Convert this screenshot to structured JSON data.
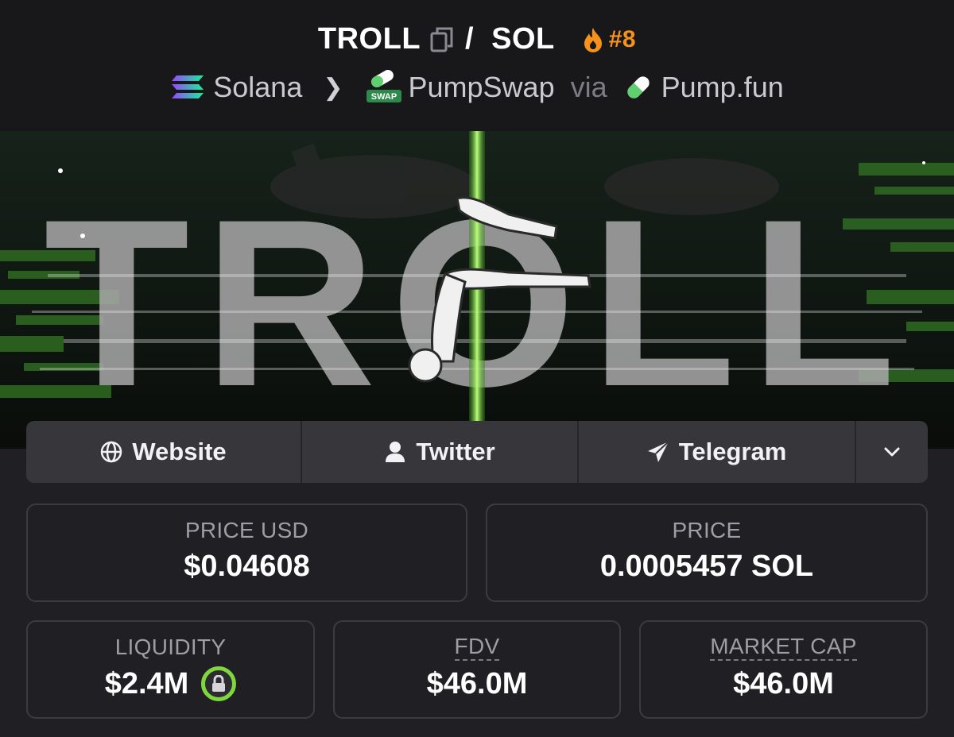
{
  "pair": {
    "base": "TROLL",
    "separator": "/",
    "quote": "SOL",
    "rank": "#8"
  },
  "route": {
    "chain": "Solana",
    "dex": "PumpSwap",
    "via_label": "via",
    "launchpad": "Pump.fun",
    "dex_badge_text": "SWAP"
  },
  "banner": {
    "text": "TROLL"
  },
  "links": {
    "website": "Website",
    "twitter": "Twitter",
    "telegram": "Telegram"
  },
  "stats": {
    "price_usd_label": "PRICE USD",
    "price_usd": "$0.04608",
    "price_label": "PRICE",
    "price": "0.0005457 SOL",
    "liquidity_label": "LIQUIDITY",
    "liquidity": "$2.4M",
    "fdv_label": "FDV",
    "fdv": "$46.0M",
    "mcap_label": "MARKET CAP",
    "mcap": "$46.0M"
  },
  "colors": {
    "rank": "#f7931a",
    "lock_ring": "#7fd73f",
    "banner_pole": "#7dff3a"
  },
  "icons": {
    "copy": "copy-icon",
    "rank": "flame-icon",
    "chain": "solana-icon",
    "dex": "pumpswap-icon",
    "launchpad": "pill-icon",
    "website": "globe-icon",
    "twitter": "user-icon",
    "telegram": "paper-plane-icon",
    "more": "chevron-down-icon",
    "liquidity": "lock-icon"
  }
}
